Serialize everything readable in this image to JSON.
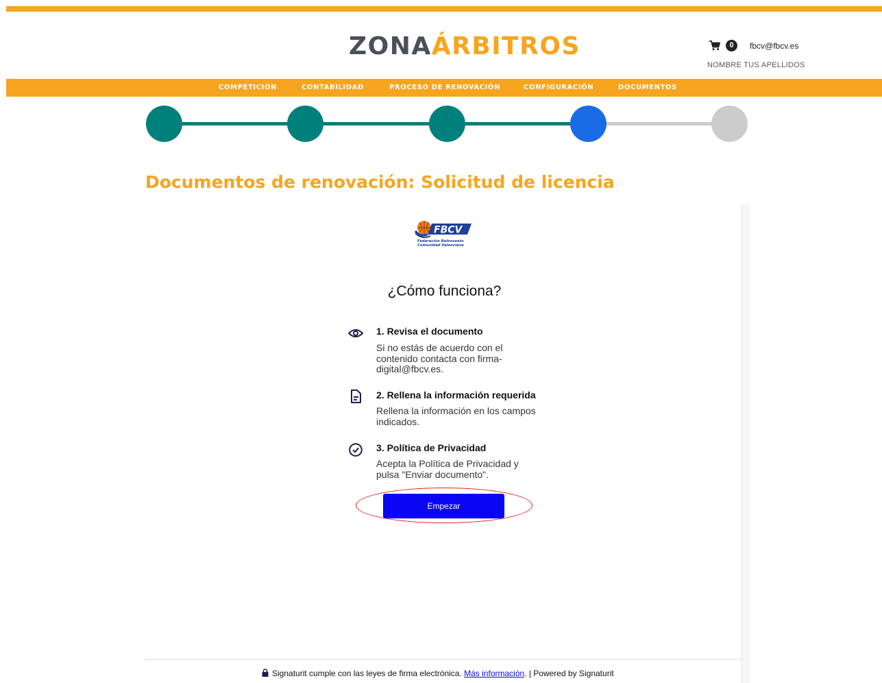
{
  "header": {
    "logo_part1": "ZONA",
    "logo_part2": "ÁRBITROS",
    "cart_count": "0",
    "user_email": "fbcv@fbcv.es",
    "user_name": "NOMBRE TUS APELLIDOS"
  },
  "nav": {
    "items": [
      "COMPETICIÓN",
      "CONTABILIDAD",
      "PROCESO DE RENOVACIÓN",
      "CONFIGURACIÓN",
      "DOCUMENTOS"
    ]
  },
  "stepper": {
    "total_steps": 5,
    "current_step": 4,
    "colors": {
      "done": "#00807a",
      "current": "#1a6be6",
      "pending": "#cccccc"
    }
  },
  "page": {
    "title": "Documentos de renovación: Solicitud de licencia"
  },
  "signing": {
    "org_logo_letters": "FBCV",
    "org_logo_line1": "Federación Baloncesto",
    "org_logo_line2": "Comunidad Valenciana",
    "how_title": "¿Cómo funciona?",
    "steps": [
      {
        "icon": "eye-icon",
        "title": "1. Revisa el documento",
        "text_lines": [
          "Si no estás de acuerdo con el",
          "contenido contacta con firma-",
          "digital@fbcv.es."
        ]
      },
      {
        "icon": "document-icon",
        "title": "2. Rellena la información requerida",
        "text_lines": [
          "Rellena la información en los campos",
          "indicados."
        ]
      },
      {
        "icon": "check-circle-icon",
        "title": "3. Política de Privacidad",
        "text_lines": [
          "Acepta la Política de Privacidad y",
          "pulsa \"Enviar documento\"."
        ]
      }
    ],
    "start_button": "Empezar"
  },
  "footer": {
    "text": "Signaturit cumple con las leyes de firma electrónica.",
    "link": "Más información",
    "suffix": ". | Powered by Signaturit"
  }
}
